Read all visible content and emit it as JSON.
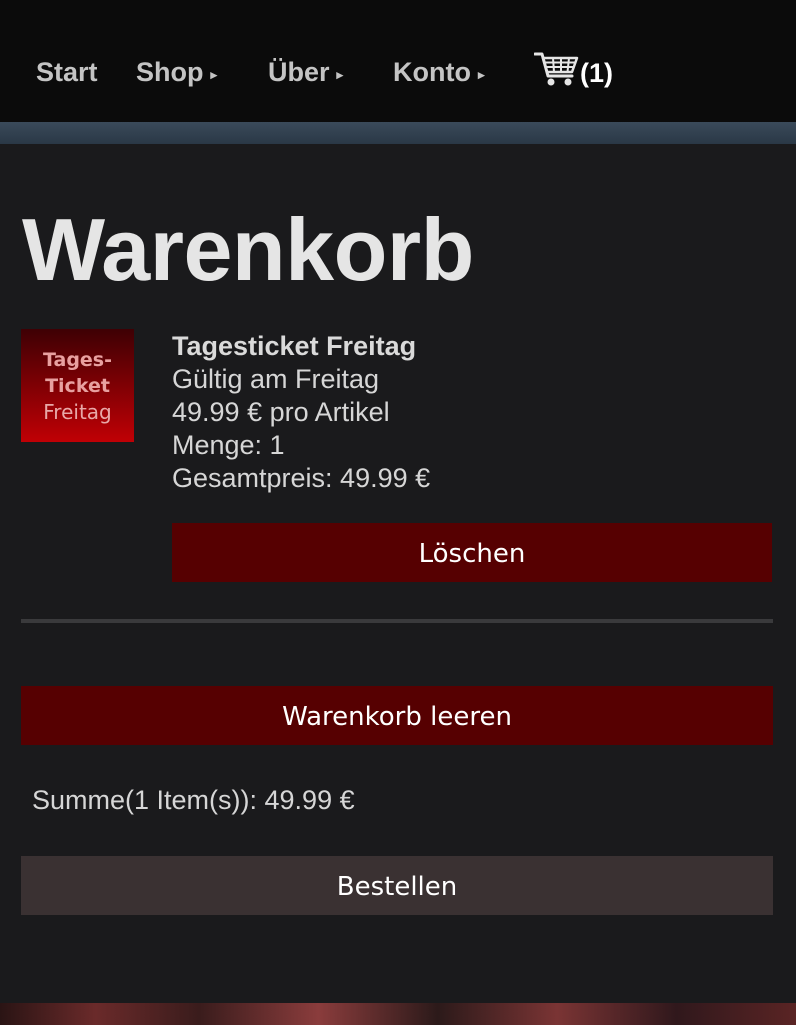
{
  "nav": {
    "start": "Start",
    "shop": "Shop",
    "ueber": "Über",
    "konto": "Konto",
    "arrow": "▸",
    "cart_count": "(1)",
    "cart_icon": "shopping-cart-icon"
  },
  "page": {
    "title": "Warenkorb"
  },
  "cart": {
    "items": [
      {
        "thumb_line1": "Tages-",
        "thumb_line2": "Ticket",
        "thumb_line3": "Freitag",
        "name": "Tagesticket Freitag",
        "description": "Gültig am Freitag",
        "unit_price": "49.99 € pro Artikel",
        "quantity": "Menge: 1",
        "total": "Gesamtpreis: 49.99 €",
        "delete_label": "Löschen"
      }
    ],
    "clear_label": "Warenkorb leeren",
    "sum_text": "Summe(1 Item(s)): 49.99 €",
    "order_label": "Bestellen"
  },
  "colors": {
    "background": "#1a1a1c",
    "navbar": "#0b0b0b",
    "danger_button": "#560001",
    "order_button": "#3a3132"
  }
}
